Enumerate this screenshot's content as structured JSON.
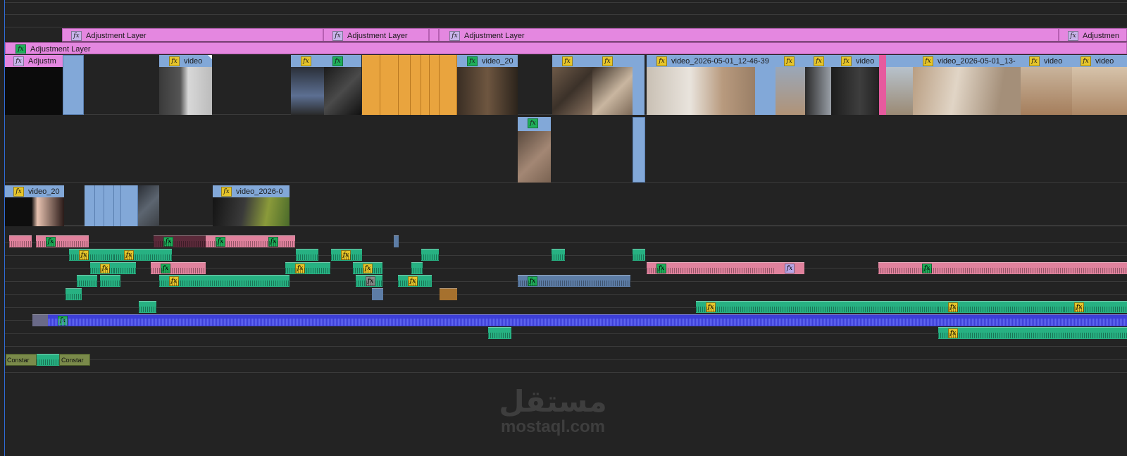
{
  "colors": {
    "adjustment": "#e487e0",
    "video_blue": "#82a8d8",
    "orange": "#e9a43e",
    "pink": "#e65a9e",
    "green_audio": "#27b182",
    "pink_audio": "#e0829d",
    "blue_audio": "#3d3fd8",
    "steel_audio": "#5d7da6",
    "playhead": "#2f6bd6",
    "background": "#232323"
  },
  "tracks": {
    "v5": {
      "clips": [
        {
          "label": "Adjustment Layer",
          "fx_color": "violet"
        },
        {
          "label": "Adjustment Layer",
          "fx_color": "violet"
        },
        {
          "label": "",
          "fx_color": "none"
        },
        {
          "label": "Adjustment Layer",
          "fx_color": "violet"
        },
        {
          "label": "Adjustmen",
          "fx_color": "violet"
        }
      ]
    },
    "v4": {
      "clips": [
        {
          "label": "Adjustment Layer",
          "fx_color": "green"
        }
      ]
    },
    "v3": {
      "clips": [
        {
          "label": "Adjustm",
          "fx_color": "violet"
        },
        {
          "label": "video",
          "fx_color": "yellow"
        },
        {
          "label": "",
          "fx_color": "yellow"
        },
        {
          "label": "",
          "fx_color": "green"
        },
        {
          "label": "video_20",
          "fx_color": "green"
        },
        {
          "label": "",
          "fx_color": "yellow"
        },
        {
          "label": "",
          "fx_color": "yellow"
        },
        {
          "label": "video_2026-05-01_12-46-39",
          "fx_color": "yellow"
        },
        {
          "label": "",
          "fx_color": "yellow"
        },
        {
          "label": "",
          "fx_color": "yellow"
        },
        {
          "label": "video",
          "fx_color": "yellow"
        },
        {
          "label": "video_2026-05-01_13-",
          "fx_color": "yellow"
        },
        {
          "label": "video",
          "fx_color": "yellow"
        },
        {
          "label": "video",
          "fx_color": "yellow"
        }
      ]
    },
    "v2": {
      "clips": [
        {
          "label": "",
          "fx_color": "green"
        }
      ]
    },
    "v1": {
      "clips": [
        {
          "label": "video_20",
          "fx_color": "yellow"
        },
        {
          "label": "video_2026-0",
          "fx_color": "yellow"
        }
      ]
    },
    "a_graphics": {
      "clips": [
        {
          "label": "Constar"
        },
        {
          "label": "Constar"
        }
      ]
    }
  },
  "watermark": {
    "logo_text": "مستقل",
    "url": "mostaql.com"
  }
}
